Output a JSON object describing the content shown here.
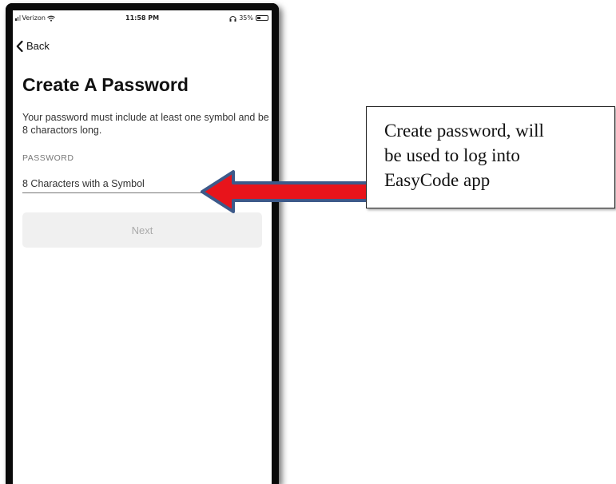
{
  "status_bar": {
    "carrier": "Verizon",
    "time": "11:58 PM",
    "battery": "35%",
    "battery_level": 0.35,
    "icons": [
      "signal-icon",
      "wifi-icon",
      "headphones-icon",
      "battery-icon"
    ]
  },
  "nav": {
    "back_label": "Back",
    "back_icon": "chevron-left-icon"
  },
  "screen": {
    "title": "Create A Password",
    "description": "Your password must include at least one symbol and be 8 charactors long.",
    "field_label": "PASSWORD",
    "field_placeholder": "8 Characters with a Symbol",
    "next_label": "Next"
  },
  "annotation": {
    "text_line1": "Create password, will",
    "text_line2": "be used to log into",
    "text_line3": "EasyCode app",
    "arrow_color": "#e8141b",
    "arrow_outline": "#3d5a8a"
  }
}
